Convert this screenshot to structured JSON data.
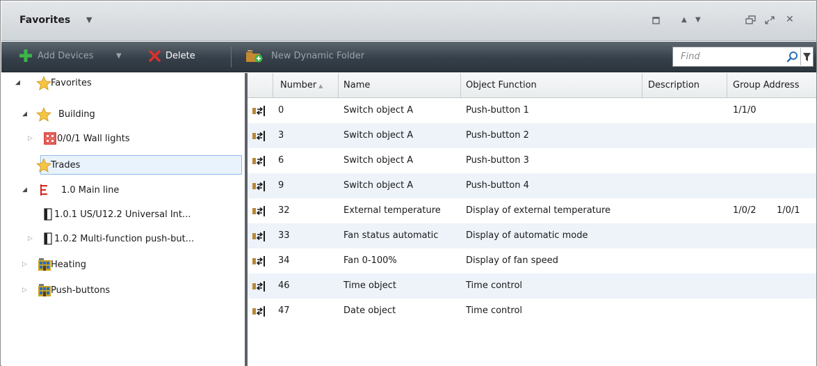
{
  "window": {
    "title": "Favorites",
    "title_menu_arrow": "▼",
    "controls": {
      "pin": "▢",
      "up": "▲",
      "down": "▼",
      "restore": "⧉",
      "maximize": "⤢",
      "close": "✕"
    }
  },
  "toolbar": {
    "add_devices_label": "Add Devices",
    "add_devices_arrow": "▼",
    "delete_label": "Delete",
    "new_dynamic_folder_label": "New Dynamic Folder",
    "find_placeholder": "Find"
  },
  "tree": {
    "items": [
      {
        "label": "Favorites",
        "expander": "◢",
        "icon": "star-icon"
      },
      {
        "label": "Building",
        "expander": "◢",
        "icon": "star-icon"
      },
      {
        "label": "0/0/1 Wall lights",
        "expander": "▷",
        "icon": "group-address-icon"
      },
      {
        "label": "Trades",
        "expander": "",
        "icon": "star-icon"
      },
      {
        "label": "1.0 Main line",
        "expander": "◢",
        "icon": "line-icon"
      },
      {
        "label": "1.0.1  US/U12.2 Universal Int...",
        "expander": "",
        "icon": "device-icon"
      },
      {
        "label": "1.0.2  Multi-function push-but...",
        "expander": "▷",
        "icon": "device-icon"
      },
      {
        "label": "Heating",
        "expander": "▷",
        "icon": "building-icon"
      },
      {
        "label": "Push-buttons",
        "expander": "▷",
        "icon": "building-icon"
      }
    ]
  },
  "grid": {
    "columns": [
      "Number",
      "Name",
      "Object Function",
      "Description",
      "Group Address"
    ],
    "sort_indicator": "▲",
    "rows": [
      {
        "number": "0",
        "name": "Switch object A",
        "function": "Push-button 1",
        "description": "",
        "group": "1/1/0",
        "group2": ""
      },
      {
        "number": "3",
        "name": "Switch object A",
        "function": "Push-button 2",
        "description": "",
        "group": "",
        "group2": ""
      },
      {
        "number": "6",
        "name": "Switch object A",
        "function": "Push-button 3",
        "description": "",
        "group": "",
        "group2": ""
      },
      {
        "number": "9",
        "name": "Switch object A",
        "function": "Push-button 4",
        "description": "",
        "group": "",
        "group2": ""
      },
      {
        "number": "32",
        "name": "External temperature",
        "function": "Display of external temperature",
        "description": "",
        "group": "1/0/2",
        "group2": "1/0/1"
      },
      {
        "number": "33",
        "name": "Fan status automatic",
        "function": "Display of automatic mode",
        "description": "",
        "group": "",
        "group2": ""
      },
      {
        "number": "34",
        "name": "Fan 0-100%",
        "function": "Display of fan speed",
        "description": "",
        "group": "",
        "group2": ""
      },
      {
        "number": "46",
        "name": "Time object",
        "function": "Time control",
        "description": "",
        "group": "",
        "group2": ""
      },
      {
        "number": "47",
        "name": "Date object",
        "function": "Time control",
        "description": "",
        "group": "",
        "group2": ""
      }
    ]
  },
  "colors": {
    "toolbar_dark": "#36404a",
    "plus_green": "#3ab54a",
    "delete_red": "#e0302a",
    "row_alt": "#edf3f9",
    "selection": "#e9f3fd"
  }
}
